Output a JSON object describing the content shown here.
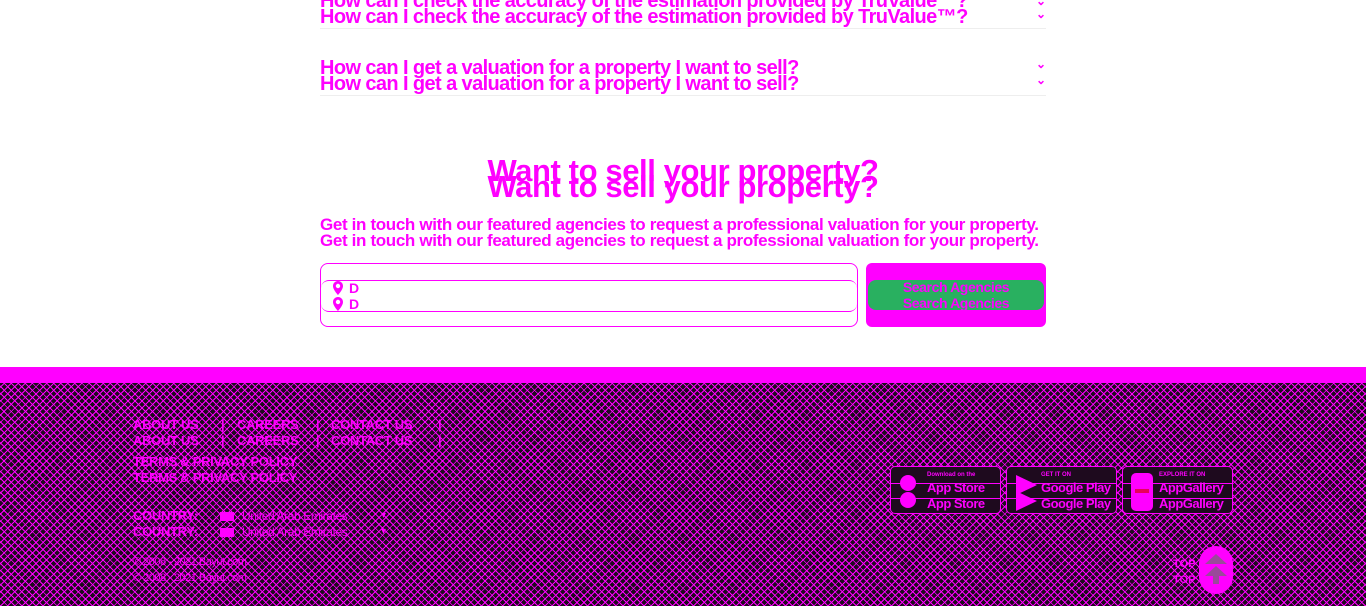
{
  "faq": {
    "items": [
      {
        "question": "How can I check the accuracy of the estimation provided by TruValue™?"
      },
      {
        "question": "How can I get a valuation for a property I want to sell?"
      }
    ]
  },
  "sell": {
    "title": "Want to sell your property?",
    "description": "Get in touch with our featured agencies to request a professional valuation for your property.",
    "search_value": "D",
    "search_button": "Search Agencies"
  },
  "footer": {
    "links": {
      "about": "ABOUT US",
      "careers": "CAREERS",
      "contact": "CONTACT US",
      "terms": "TERMS & PRIVACY POLICY"
    },
    "separator": "|",
    "country_label": "COUNTRY:",
    "country_value": "United Arab Emirates",
    "copyright": "© 2008 - 2021 Bayut.com",
    "top_label": "TOP",
    "badges": {
      "appstore": {
        "small": "Download on the",
        "big": "App Store"
      },
      "googleplay": {
        "small": "GET IT ON",
        "big": "Google Play"
      },
      "appgallery": {
        "small": "EXPLORE IT ON",
        "big": "AppGallery"
      }
    },
    "accent_color": "#ff00ff",
    "button_color": "#29b060"
  }
}
